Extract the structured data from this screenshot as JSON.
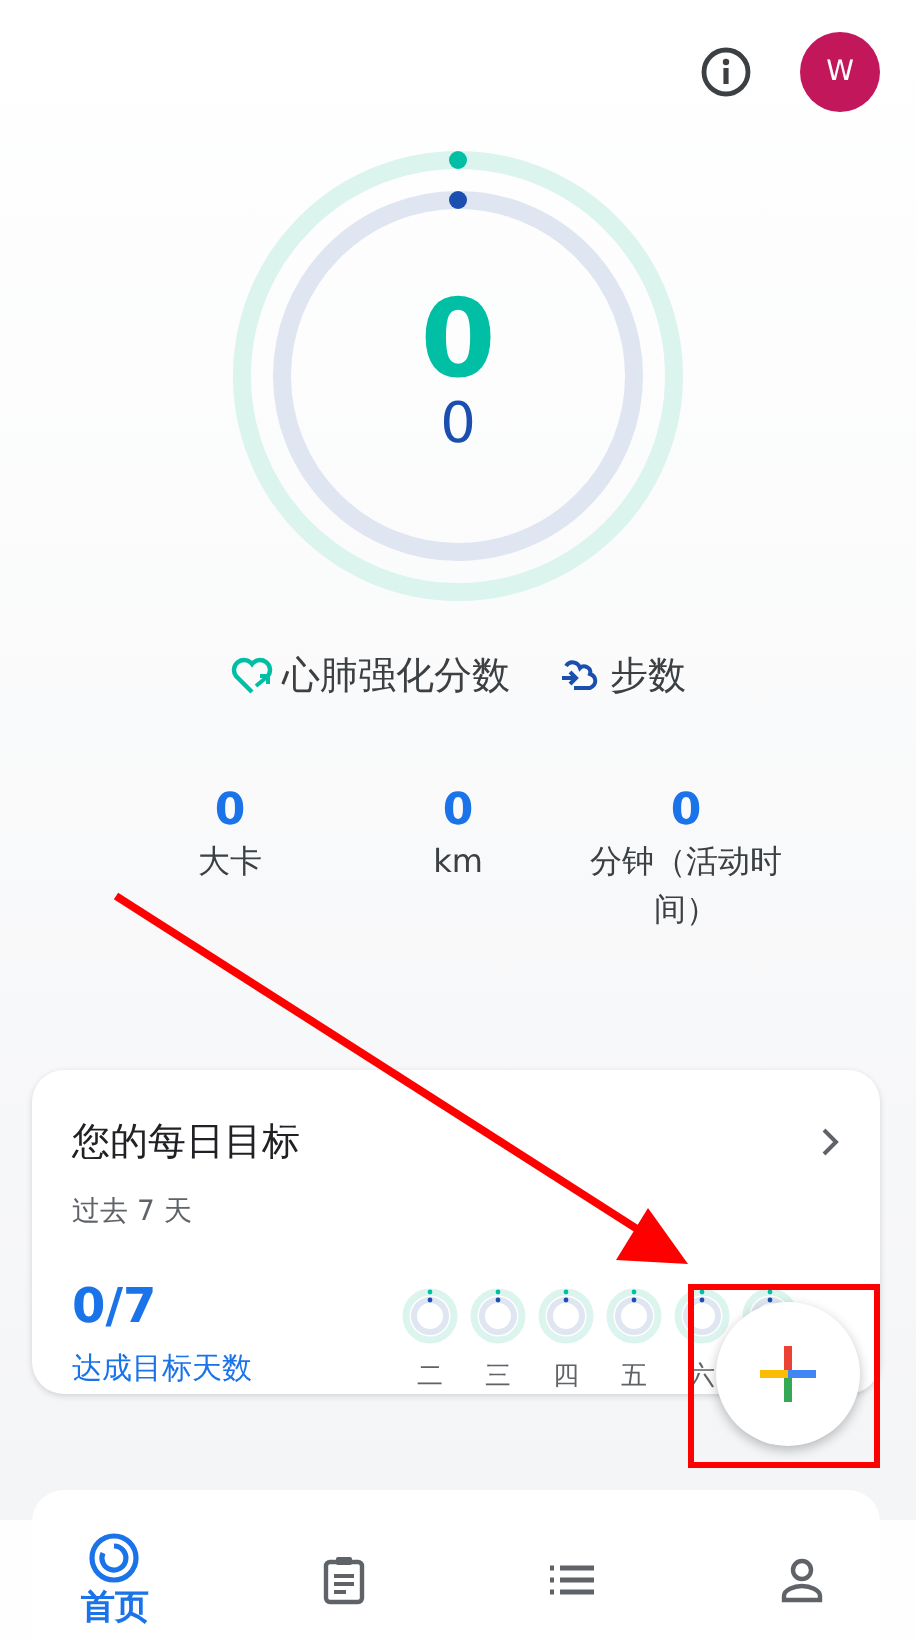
{
  "header": {
    "avatar": "W"
  },
  "rings": {
    "heart_points": "0",
    "steps": "0"
  },
  "legend": [
    {
      "kind": "heart",
      "label": "心肺强化分数"
    },
    {
      "kind": "steps",
      "label": "步数"
    }
  ],
  "stats": [
    {
      "value": "0",
      "unit": "大卡"
    },
    {
      "value": "0",
      "unit": "km"
    },
    {
      "value": "0",
      "unit": "分钟（活动时间）"
    }
  ],
  "daily_goals": {
    "title": "您的每日目标",
    "subtitle": "过去 7 天",
    "count": "0/7",
    "count_label": "达成目标天数",
    "days": [
      {
        "label": "二"
      },
      {
        "label": "三"
      },
      {
        "label": "四"
      },
      {
        "label": "五"
      },
      {
        "label": "六"
      }
    ]
  },
  "nav": [
    {
      "kind": "home",
      "label": "首页",
      "selected": true
    },
    {
      "kind": "journal",
      "selected": false
    },
    {
      "kind": "browse",
      "selected": false
    },
    {
      "kind": "profile",
      "selected": false
    }
  ]
}
